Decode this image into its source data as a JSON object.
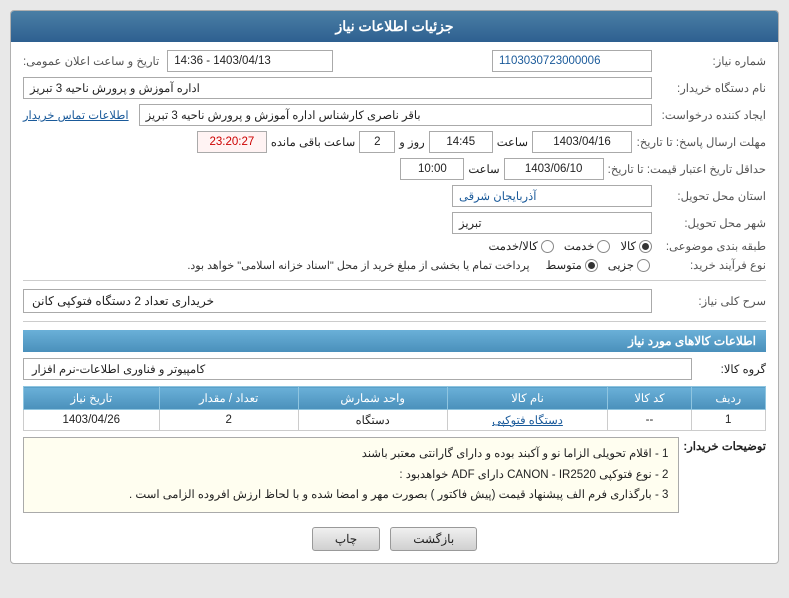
{
  "header": {
    "title": "جزئیات اطلاعات نیاز"
  },
  "fields": {
    "shenaze_label": "شماره نیاز:",
    "shenaze_value": "1103030723000006",
    "date_time_label": "تاریخ و ساعت اعلان عمومی:",
    "date_time_value": "1403/04/13 - 14:36",
    "buyer_label": "نام دستگاه خریدار:",
    "buyer_value": "اداره آموزش و پرورش ناحیه 3 تبریز",
    "creator_label": "ایجاد کننده درخواست:",
    "creator_value": "باقر ناصری کارشناس اداره آموزش و پرورش ناحیه 3 تبریز",
    "contact_link": "اطلاعات تماس خریدار",
    "reply_deadline_label": "مهلت ارسال پاسخ: تا تاریخ:",
    "reply_date": "1403/04/16",
    "reply_time_label": "ساعت",
    "reply_time": "14:45",
    "reply_day_label": "روز و",
    "reply_days": "2",
    "reply_remain_label": "ساعت باقی مانده",
    "reply_remain": "23:20:27",
    "validity_label": "حداقل تاریخ اعتبار قیمت: تا تاریخ:",
    "validity_date": "1403/06/10",
    "validity_time_label": "ساعت",
    "validity_time": "10:00",
    "province_label": "استان محل تحویل:",
    "province_value": "آذربایجان شرقی",
    "city_label": "شهر محل تحویل:",
    "city_value": "تبریز",
    "category_label": "طبقه بندی موضوعی:",
    "category_options": [
      "کالا",
      "خدمت",
      "کالا/خدمت"
    ],
    "category_selected": "کالا",
    "purchase_type_label": "نوع فرآیند خرید:",
    "purchase_type_options": [
      "جزیی",
      "متوسط"
    ],
    "purchase_type_selected": "متوسط",
    "purchase_note": "پرداخت تمام یا بخشی از مبلغ خرید از محل \"اسناد خزانه اسلامی\" خواهد بود."
  },
  "serp": {
    "label": "سرح کلی نیاز:",
    "value": "خریداری تعداد 2 دستگاه فتوکپی کانن"
  },
  "goods_section": {
    "title": "اطلاعات کالاهای مورد نیاز"
  },
  "group": {
    "label": "گروه کالا:",
    "value": "کامپیوتر و فناوری اطلاعات-نرم افزار"
  },
  "table": {
    "headers": [
      "ردیف",
      "کد کالا",
      "نام کالا",
      "واحد شمارش",
      "تعداد / مقدار",
      "تاریخ نیاز"
    ],
    "rows": [
      {
        "row": "1",
        "code": "--",
        "name": "دستگاه فتوکپی",
        "unit": "دستگاه",
        "qty": "2",
        "date": "1403/04/26"
      }
    ]
  },
  "notes": {
    "label": "توضیحات خریدار:",
    "lines": [
      "1 - اقلام تحویلی الزاما نو و آکبند بوده و دارای گارانتی معتبر باشند",
      "2 - نوع فتوکپی CANON - IR2520  دارای  ADF  خواهدبود :",
      "3 - بارگذاری فرم الف پیشنهاد قیمت (پیش فاکتور ) بصورت مهر و امضا شده و با لحاظ ارزش افروده الزامی است ."
    ]
  },
  "buttons": {
    "print": "چاپ",
    "back": "بازگشت"
  }
}
